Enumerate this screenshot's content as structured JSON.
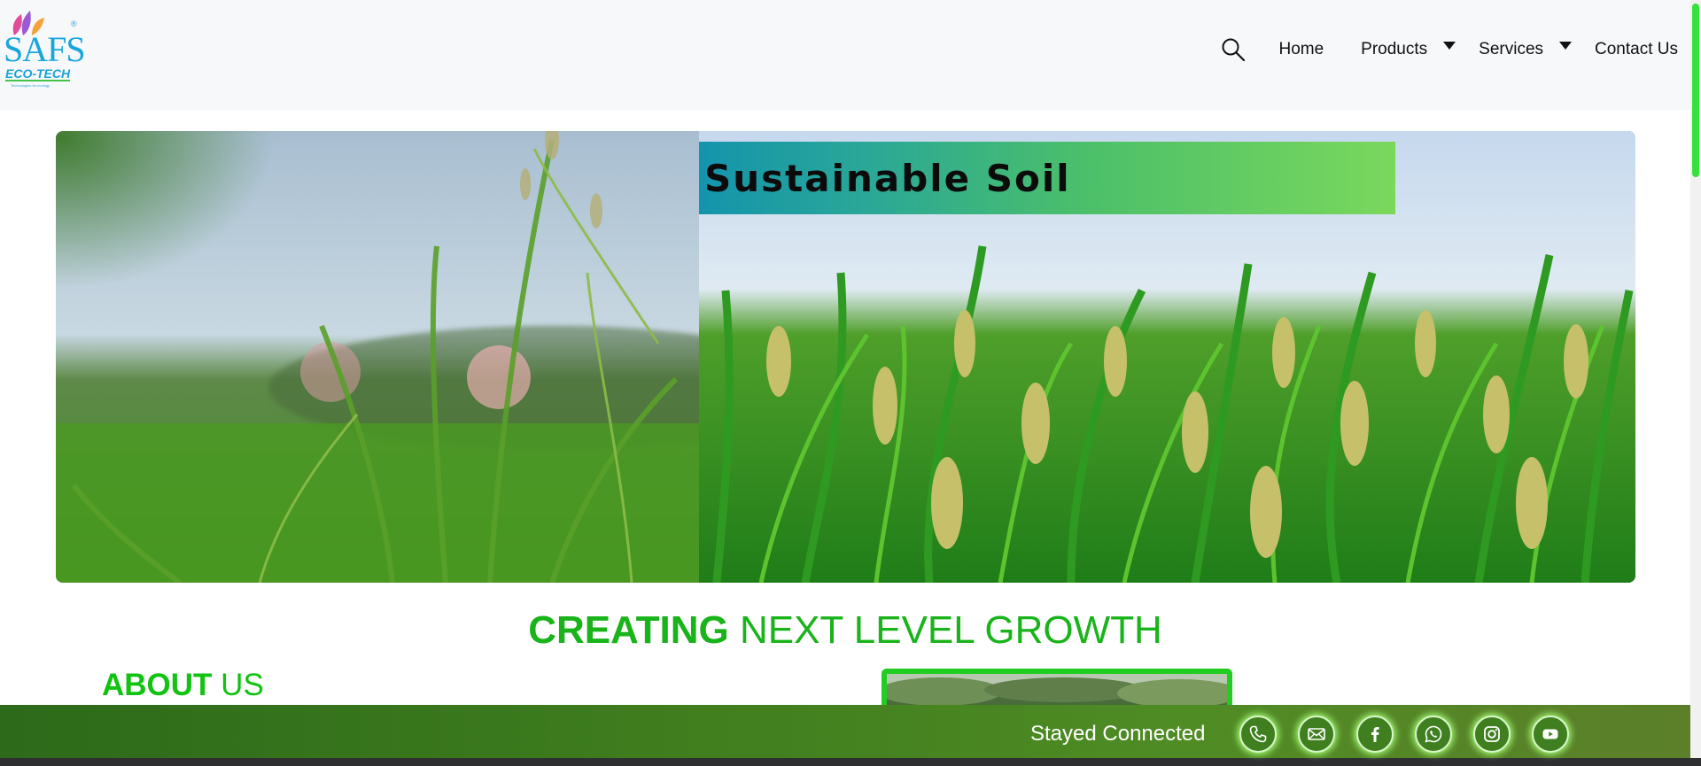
{
  "header": {
    "logo": {
      "main": "SAFS",
      "sub": "ECO-TECH",
      "tagline": "Technologies for ecology",
      "reg": "®"
    },
    "nav": [
      {
        "label": "Home"
      },
      {
        "label": "Products"
      },
      {
        "label": "Services"
      },
      {
        "label": "Contact Us"
      }
    ],
    "search_icon": "search-icon"
  },
  "banner": {
    "title": "Sustainable Soil"
  },
  "tagline": {
    "bold": "CREATING",
    "rest": " NEXT LEVEL GROWTH"
  },
  "about": {
    "bold": "ABOUT",
    "rest": " US"
  },
  "footer": {
    "text": "Stayed Connected",
    "icons": [
      "phone-icon",
      "email-icon",
      "facebook-icon",
      "whatsapp-icon",
      "instagram-icon",
      "youtube-icon"
    ]
  },
  "colors": {
    "accent_green": "#19b31a",
    "scrollbar_green": "#35e13a",
    "footer_green": "#3f7d1e"
  }
}
